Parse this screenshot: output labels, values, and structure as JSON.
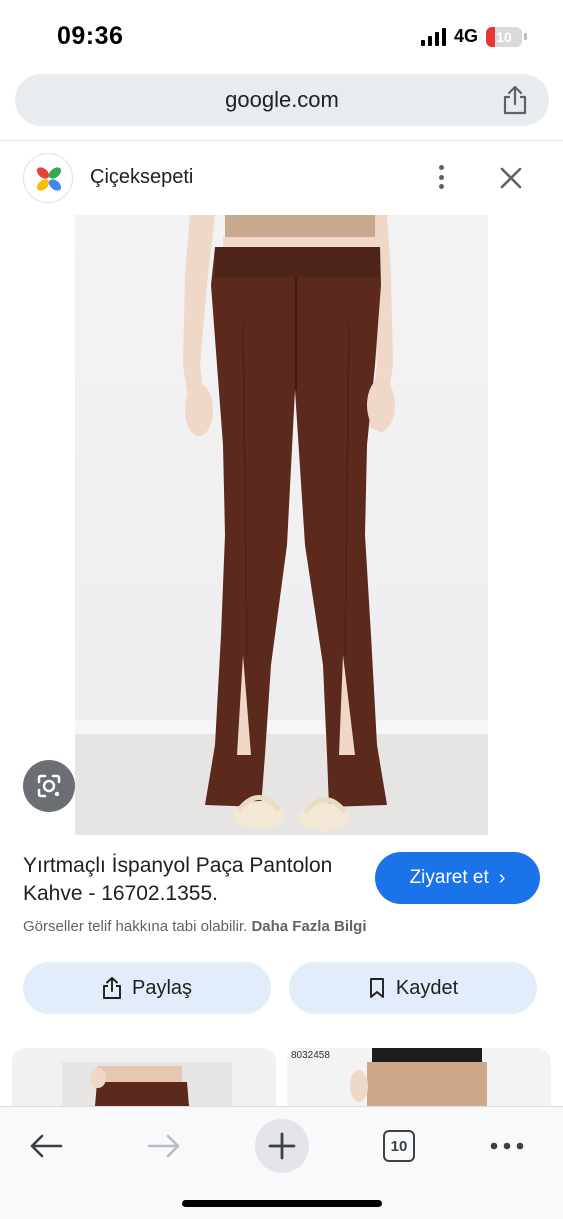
{
  "status_bar": {
    "time": "09:36",
    "network": "4G",
    "battery": "10"
  },
  "url_bar": {
    "url": "google.com",
    "share_icon": "share-icon"
  },
  "source": {
    "name": "Çiçeksepeti",
    "logo_icon": "flower-logo-icon",
    "more_icon": "more-vertical-icon",
    "close_icon": "close-icon"
  },
  "image": {
    "lens_icon": "google-lens-icon"
  },
  "product": {
    "title": "Yırtmaçlı İspanyol Paça Pantolon Kahve - 16702.1355.",
    "visit_label": "Ziyaret et",
    "copyright_text": "Görseller telif hakkına tabi olabilir.",
    "more_info_link": "Daha Fazla Bilgi"
  },
  "actions": {
    "share_label": "Paylaş",
    "save_label": "Kaydet"
  },
  "related": {
    "card2_code": "8032458"
  },
  "toolbar": {
    "tab_count": "10"
  },
  "colors": {
    "accent": "#1a73e8",
    "pill_bg": "#e3ecfa",
    "pants": "#5b2a1c"
  }
}
